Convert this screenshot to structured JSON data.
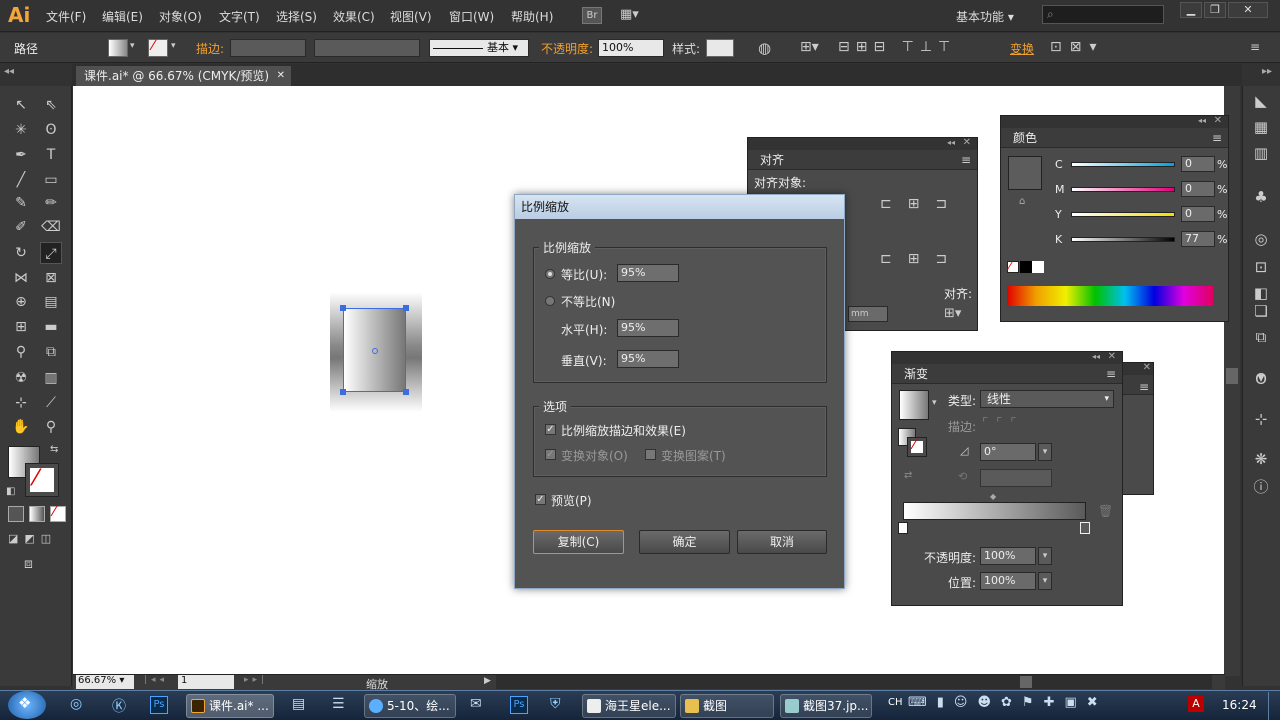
{
  "app": {
    "logo": "Ai",
    "menus": [
      "文件(F)",
      "编辑(E)",
      "对象(O)",
      "文字(T)",
      "选择(S)",
      "效果(C)",
      "视图(V)",
      "窗口(W)",
      "帮助(H)"
    ],
    "br_label": "Br",
    "workspace": "基本功能",
    "search_placeholder": ""
  },
  "control": {
    "selection_type": "路径",
    "stroke_label": "描边:",
    "stroke_style": "基本",
    "opacity_label": "不透明度:",
    "opacity_value": "100%",
    "style_label": "样式:",
    "transform_label": "变换"
  },
  "document": {
    "tab_title": "课件.ai* @ 66.67% (CMYK/预览)"
  },
  "status": {
    "zoom": "66.67%",
    "page": "1",
    "tool_name": "缩放"
  },
  "dialog": {
    "title": "比例缩放",
    "scale_group": "比例缩放",
    "uniform_label": "等比(U):",
    "uniform_value": "95%",
    "nonuniform_label": "不等比(N)",
    "horizontal_label": "水平(H):",
    "horizontal_value": "95%",
    "vertical_label": "垂直(V):",
    "vertical_value": "95%",
    "options_group": "选项",
    "scale_strokes_label": "比例缩放描边和效果(E)",
    "transform_objects_label": "变换对象(O)",
    "transform_patterns_label": "变换图案(T)",
    "preview_label": "预览(P)",
    "copy_button": "复制(C)",
    "ok_button": "确定",
    "cancel_button": "取消"
  },
  "align_panel": {
    "title": "对齐",
    "align_objects_label": "对齐对象:",
    "align_to_label": "对齐:",
    "unit": "mm"
  },
  "color_panel": {
    "title": "颜色",
    "channels": [
      {
        "name": "C",
        "value": "0",
        "unit": "%"
      },
      {
        "name": "M",
        "value": "0",
        "unit": "%"
      },
      {
        "name": "Y",
        "value": "0",
        "unit": "%"
      },
      {
        "name": "K",
        "value": "77",
        "unit": "%"
      }
    ]
  },
  "gradient_panel": {
    "title": "渐变",
    "type_label": "类型:",
    "type_value": "线性",
    "stroke_label": "描边:",
    "angle_value": "0°",
    "opacity_label": "不透明度:",
    "opacity_value": "100%",
    "location_label": "位置:",
    "location_value": "100%"
  },
  "taskbar": {
    "items": [
      "课件.ai* ...",
      "5-10、绘...",
      "海王星ele...",
      "截图",
      "截图37.jp..."
    ],
    "lang": "CH",
    "time": "16:24"
  }
}
